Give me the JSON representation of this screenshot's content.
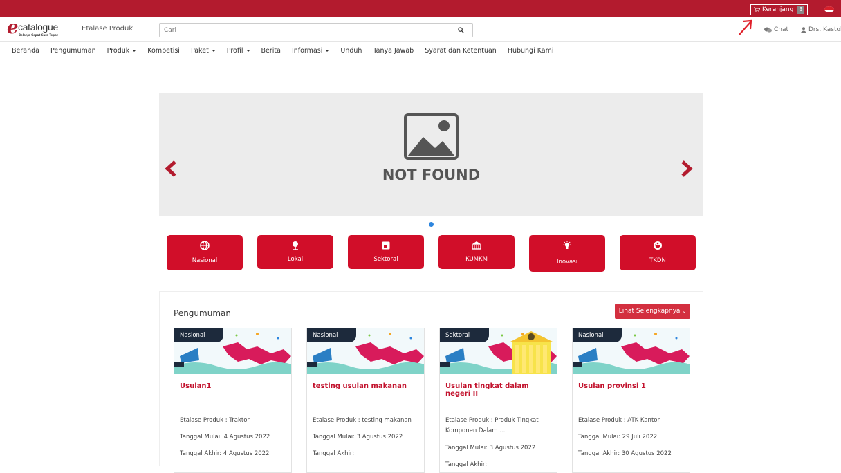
{
  "topbar": {
    "cart_label": "Keranjang",
    "cart_count": "3"
  },
  "header": {
    "logo_word": "catalogue",
    "logo_tagline": "Belanja Cepat Cara Tepat",
    "etalase_label": "Etalase Produk",
    "search_placeholder": "Cari",
    "chat_label": "Chat",
    "user_label": "Drs. Kastol"
  },
  "nav": {
    "items": [
      {
        "label": "Beranda",
        "dropdown": false
      },
      {
        "label": "Pengumuman",
        "dropdown": false
      },
      {
        "label": "Produk",
        "dropdown": true
      },
      {
        "label": "Kompetisi",
        "dropdown": false
      },
      {
        "label": "Paket",
        "dropdown": true
      },
      {
        "label": "Profil",
        "dropdown": true
      },
      {
        "label": "Berita",
        "dropdown": false
      },
      {
        "label": "Informasi",
        "dropdown": true
      },
      {
        "label": "Unduh",
        "dropdown": false
      },
      {
        "label": "Tanya Jawab",
        "dropdown": false
      },
      {
        "label": "Syarat dan Ketentuan",
        "dropdown": false
      },
      {
        "label": "Hubungi Kami",
        "dropdown": false
      }
    ]
  },
  "carousel": {
    "image_text": "NOT FOUND"
  },
  "categories": [
    {
      "label": "Nasional",
      "icon": "globe-icon"
    },
    {
      "label": "Lokal",
      "icon": "map-pin-icon"
    },
    {
      "label": "Sektoral",
      "icon": "square-icon"
    },
    {
      "label": "KUMKM",
      "icon": "basket-icon"
    },
    {
      "label": "Inovasi",
      "icon": "lightbulb-icon"
    },
    {
      "label": "TKDN",
      "icon": "garuda-icon"
    }
  ],
  "announcements": {
    "title": "Pengumuman",
    "more_label": "Lihat Selengkapnya",
    "cards": [
      {
        "tag": "Nasional",
        "title": "Usulan1",
        "etalase": "Etalase Produk : Traktor",
        "mulai": "Tanggal Mulai: 4 Agustus 2022",
        "akhir": "Tanggal Akhir: 4 Agustus 2022"
      },
      {
        "tag": "Nasional",
        "title": "testing usulan makanan",
        "etalase": "Etalase Produk : testing makanan",
        "mulai": "Tanggal Mulai: 3 Agustus 2022",
        "akhir": "Tanggal Akhir:"
      },
      {
        "tag": "Sektoral",
        "title": "Usulan tingkat dalam negeri II",
        "etalase": "Etalase Produk : Produk Tingkat Komponen Dalam ...",
        "mulai": "Tanggal Mulai: 3 Agustus 2022",
        "akhir": "Tanggal Akhir:"
      },
      {
        "tag": "Nasional",
        "title": "Usulan provinsi 1",
        "etalase": "Etalase Produk : ATK Kantor",
        "mulai": "Tanggal Mulai: 29 Juli 2022",
        "akhir": "Tanggal Akhir: 30 Agustus 2022"
      }
    ]
  },
  "colors": {
    "brand_red": "#b31b2e",
    "category_red": "#d10e29",
    "tag_navy": "#1d2a3c"
  }
}
